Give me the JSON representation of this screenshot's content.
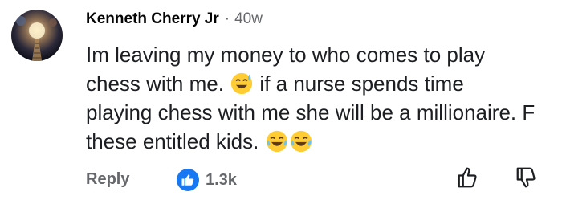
{
  "comment": {
    "author": "Kenneth Cherry Jr",
    "separator": "·",
    "time": "40w",
    "text_part1": "Im leaving my money to who comes to play chess with me.",
    "text_part2": " if a nurse spends time playing chess with me she will be a millionaire. F these entitled kids.",
    "emoji_1": "sweat-smile-emoji",
    "emoji_2": "tears-of-joy-emoji"
  },
  "actions": {
    "reply_label": "Reply",
    "reaction_icon": "like-icon",
    "reaction_count": "1.3k",
    "upvote_icon": "thumbs-up-outline-icon",
    "downvote_icon": "thumbs-down-outline-icon"
  },
  "colors": {
    "text": "#1c1e21",
    "muted": "#65676b",
    "like_blue": "#1877f2"
  }
}
